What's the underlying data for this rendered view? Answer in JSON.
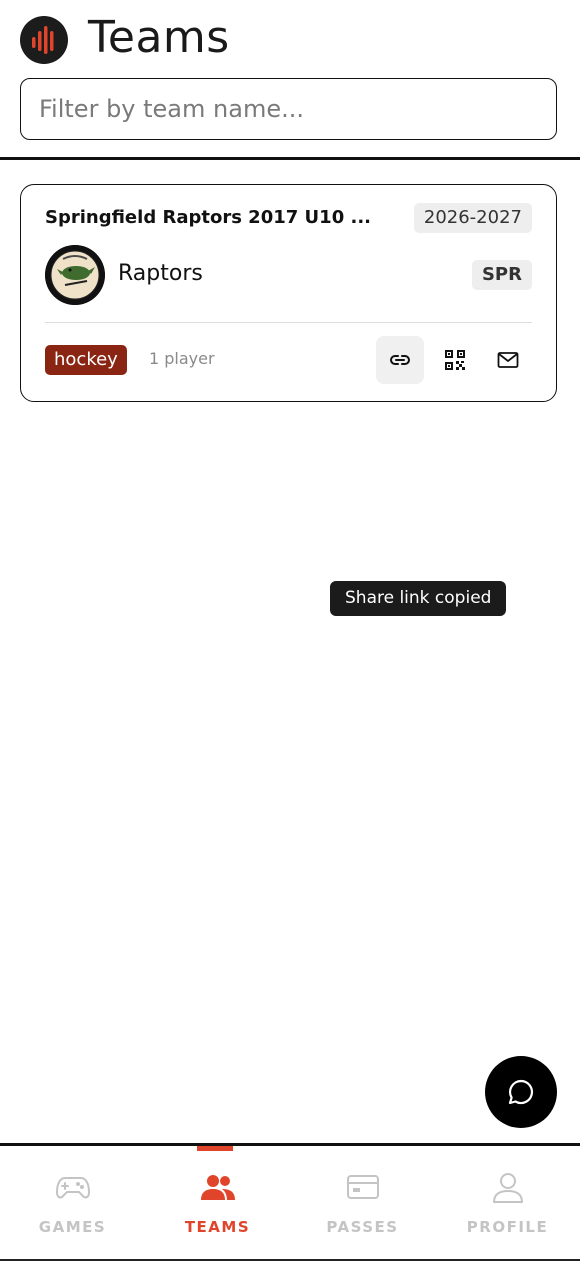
{
  "header": {
    "title": "Teams",
    "filter_placeholder": "Filter by team name..."
  },
  "team_card": {
    "name": "Springfield Raptors 2017 U10 ...",
    "season": "2026-2027",
    "short_name": "Raptors",
    "abbreviation": "SPR",
    "sport": "hockey",
    "player_count": "1 player",
    "actions": [
      "link-icon",
      "qr-code-icon",
      "mail-icon"
    ]
  },
  "toast": {
    "message": "Share link copied"
  },
  "tabbar": {
    "tabs": [
      {
        "label": "GAMES",
        "icon": "gamepad-icon",
        "active": false
      },
      {
        "label": "TEAMS",
        "icon": "users-icon",
        "active": true
      },
      {
        "label": "PASSES",
        "icon": "pass-card-icon",
        "active": false
      },
      {
        "label": "PROFILE",
        "icon": "profile-icon",
        "active": false
      }
    ]
  },
  "colors": {
    "accent": "#e0452b",
    "sport_badge": "#8a2514",
    "inactive": "#c4c4c4",
    "toast_bg": "#1b1b1b"
  }
}
